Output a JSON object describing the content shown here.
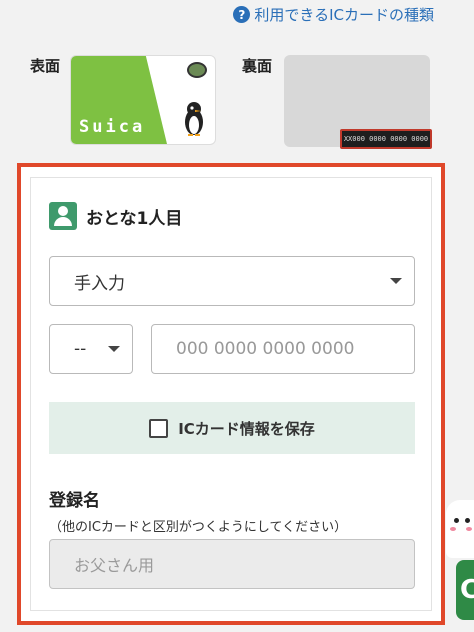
{
  "help": {
    "icon": "question-circle-icon",
    "label": "利用できるICカードの種類"
  },
  "card_images": {
    "front_label": "表面",
    "back_label": "裏面",
    "front_brand": "Suica",
    "back_number_sample": "XX000 0000 0000 0000"
  },
  "form": {
    "person_title": "おとな1人目",
    "person_icon": "person-icon",
    "input_method": {
      "value": "手入力"
    },
    "prefix": {
      "value": "--"
    },
    "card_number": {
      "placeholder": "000 0000 0000 0000"
    },
    "save_checkbox_label": "ICカード情報を保存",
    "registration": {
      "label": "登録名",
      "hint": "（他のICカードと区別がつくようにしてください）",
      "placeholder": "お父さん用"
    }
  },
  "edge_button_text": "C",
  "colors": {
    "accent_frame": "#e0482a",
    "link": "#2a6fb8",
    "green": "#3f9a6c",
    "save_bg": "#e3efe9"
  }
}
